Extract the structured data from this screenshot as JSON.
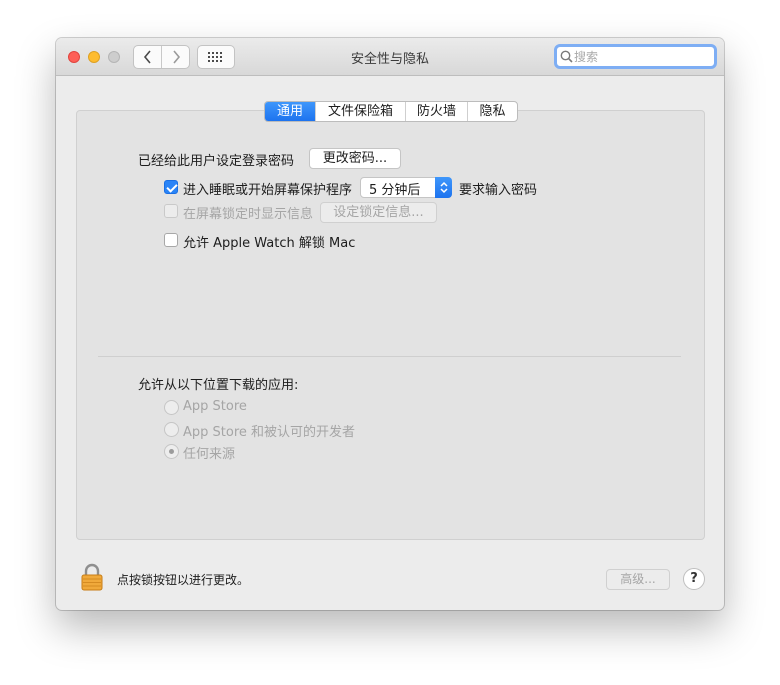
{
  "window": {
    "title": "安全性与隐私"
  },
  "toolbar": {
    "back_label": "‹",
    "forward_label": "›"
  },
  "search": {
    "placeholder": "搜索",
    "value": ""
  },
  "tabs": [
    {
      "label": "通用",
      "active": true
    },
    {
      "label": "文件保险箱",
      "active": false
    },
    {
      "label": "防火墙",
      "active": false
    },
    {
      "label": "隐私",
      "active": false
    }
  ],
  "general": {
    "password_label": "已经给此用户设定登录密码",
    "change_password_button": "更改密码...",
    "require_password": {
      "checked": true,
      "label": "进入睡眠或开始屏幕保护程序",
      "delay_value": "5 分钟后",
      "suffix": "要求输入密码"
    },
    "show_message": {
      "checked": false,
      "enabled": false,
      "label": "在屏幕锁定时显示信息",
      "button": "设定锁定信息..."
    },
    "apple_watch": {
      "checked": false,
      "label": "允许 Apple Watch 解锁 Mac"
    }
  },
  "downloads": {
    "heading": "允许从以下位置下载的应用:",
    "options": [
      {
        "label": "App Store",
        "selected": false
      },
      {
        "label": "App Store 和被认可的开发者",
        "selected": false
      },
      {
        "label": "任何来源",
        "selected": true
      }
    ]
  },
  "footer": {
    "lock_text": "点按锁按钮以进行更改。",
    "advanced_button": "高级...",
    "help_label": "?"
  },
  "colors": {
    "accent": "#1d73ef",
    "disabled_text": "#a5a5a5"
  }
}
